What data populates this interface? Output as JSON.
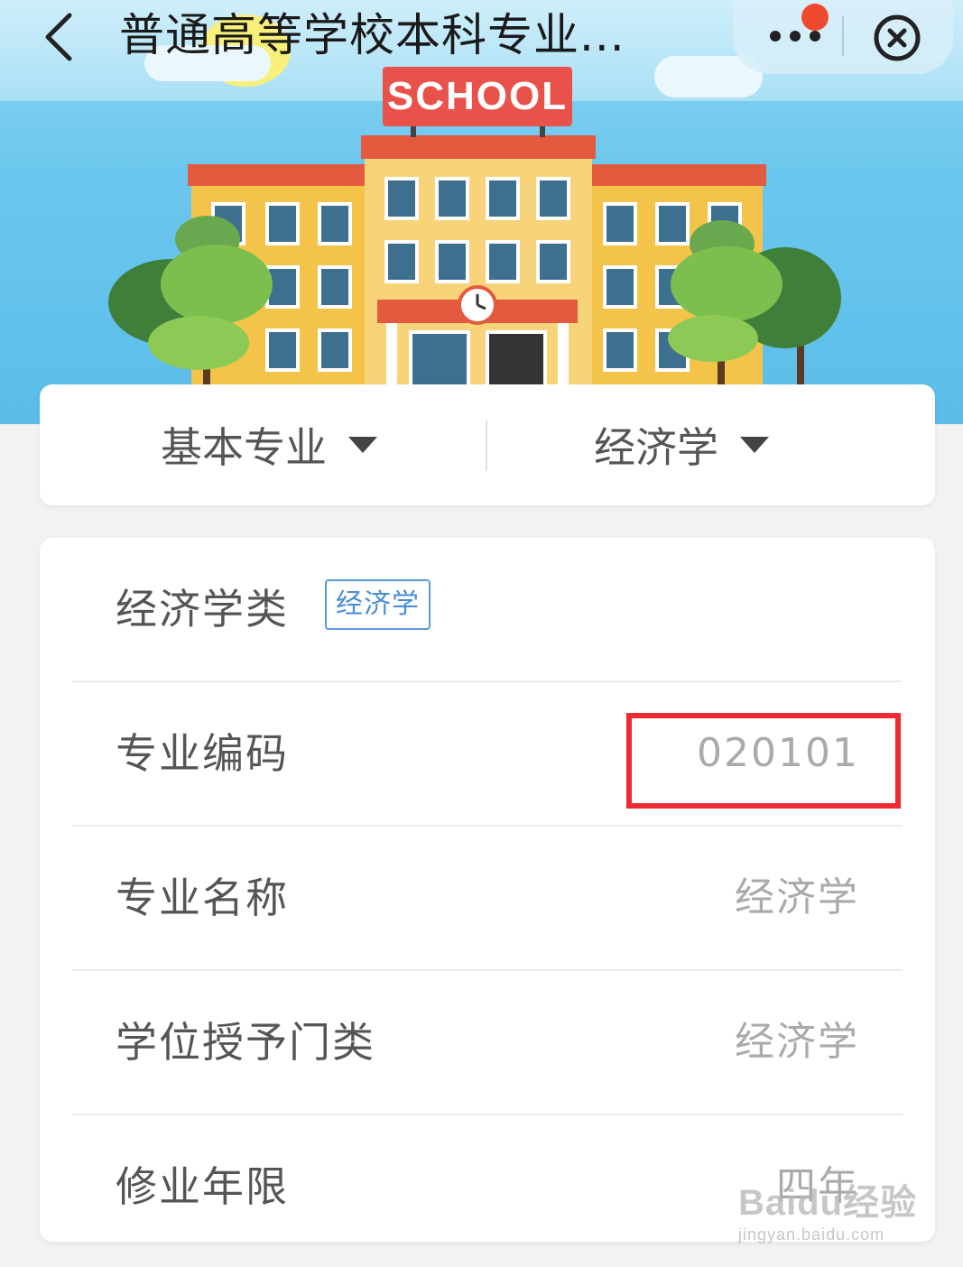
{
  "nav": {
    "title": "普通高等学校本科专业...",
    "back_icon": "chevron-left-icon",
    "more_icon": "more-dots-icon",
    "close_icon": "close-circle-icon",
    "notification_dot_color": "#f04a2e"
  },
  "banner": {
    "sign_text": "SCHOOL",
    "sign_color": "#e9524a"
  },
  "filters": {
    "category": "基本专业",
    "subject": "经济学"
  },
  "detail": {
    "group_title": "经济学类",
    "group_tag": "经济学",
    "rows": [
      {
        "label": "专业编码",
        "value": "020101"
      },
      {
        "label": "专业名称",
        "value": "经济学"
      },
      {
        "label": "学位授予门类",
        "value": "经济学"
      },
      {
        "label": "修业年限",
        "value": "四年"
      }
    ]
  },
  "colors": {
    "highlight": "#ee2b33",
    "tag_blue": "#4a8fd6"
  },
  "watermark": {
    "logo": "Baidu经验",
    "url": "jingyan.baidu.com"
  }
}
